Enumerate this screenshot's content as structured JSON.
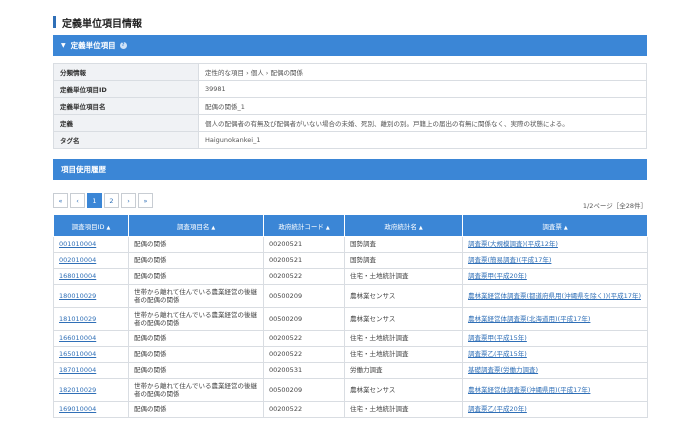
{
  "page_title": "定義単位項目情報",
  "section1": {
    "title": "定義単位項目",
    "help_icon": "?"
  },
  "info": [
    {
      "key": "分類情報",
      "value": "定性的な項目 › 個人 › 配偶の関係"
    },
    {
      "key": "定義単位項目ID",
      "value": "39981"
    },
    {
      "key": "定義単位項目名",
      "value": "配偶の関係_1"
    },
    {
      "key": "定義",
      "value": "個人の配偶者の有無及び配偶者がいない場合の未婚、死別、離別の別。戸籍上の届出の有無に関係なく、実際の状態による。"
    },
    {
      "key": "タグ名",
      "value": "Haigunokankei_1"
    }
  ],
  "section2": {
    "title": "項目使用履歴"
  },
  "pager": {
    "first": "«",
    "prev": "‹",
    "pages": [
      "1",
      "2",
      "›",
      "»"
    ],
    "info": "1/2ページ［全28件］"
  },
  "table": {
    "headers": [
      "調査項目ID",
      "調査項目名",
      "政府統計コード",
      "政府統計名",
      "調査票"
    ],
    "sort_icon": "▲",
    "rows": [
      {
        "id": "001010004",
        "name": "配偶の関係",
        "code": "00200521",
        "stat": "国勢調査",
        "form": "調査票(大規模調査)(平成12年)"
      },
      {
        "id": "002010004",
        "name": "配偶の関係",
        "code": "00200521",
        "stat": "国勢調査",
        "form": "調査票(簡易調査)(平成17年)"
      },
      {
        "id": "168010004",
        "name": "配偶の関係",
        "code": "00200522",
        "stat": "住宅・土地統計調査",
        "form": "調査票甲(平成20年)"
      },
      {
        "id": "180010029",
        "name": "世帯から離れて住んでいる農業経営の後継者の配偶の関係",
        "code": "00500209",
        "stat": "農林業センサス",
        "form": "農林業経営体調査票(都道府県用(沖縄県を除く))(平成17年)"
      },
      {
        "id": "181010029",
        "name": "世帯から離れて住んでいる農業経営の後継者の配偶の関係",
        "code": "00500209",
        "stat": "農林業センサス",
        "form": "農林業経営体調査票(北海道用)(平成17年)"
      },
      {
        "id": "166010004",
        "name": "配偶の関係",
        "code": "00200522",
        "stat": "住宅・土地統計調査",
        "form": "調査票甲(平成15年)"
      },
      {
        "id": "165010004",
        "name": "配偶の関係",
        "code": "00200522",
        "stat": "住宅・土地統計調査",
        "form": "調査票乙(平成15年)"
      },
      {
        "id": "187010004",
        "name": "配偶の関係",
        "code": "00200531",
        "stat": "労働力調査",
        "form": "基礎調査票(労働力調査)"
      },
      {
        "id": "182010029",
        "name": "世帯から離れて住んでいる農業経営の後継者の配偶の関係",
        "code": "00500209",
        "stat": "農林業センサス",
        "form": "農林業経営体調査票(沖縄県用)(平成17年)"
      },
      {
        "id": "169010004",
        "name": "配偶の関係",
        "code": "00200522",
        "stat": "住宅・土地統計調査",
        "form": "調査票乙(平成20年)"
      }
    ]
  }
}
